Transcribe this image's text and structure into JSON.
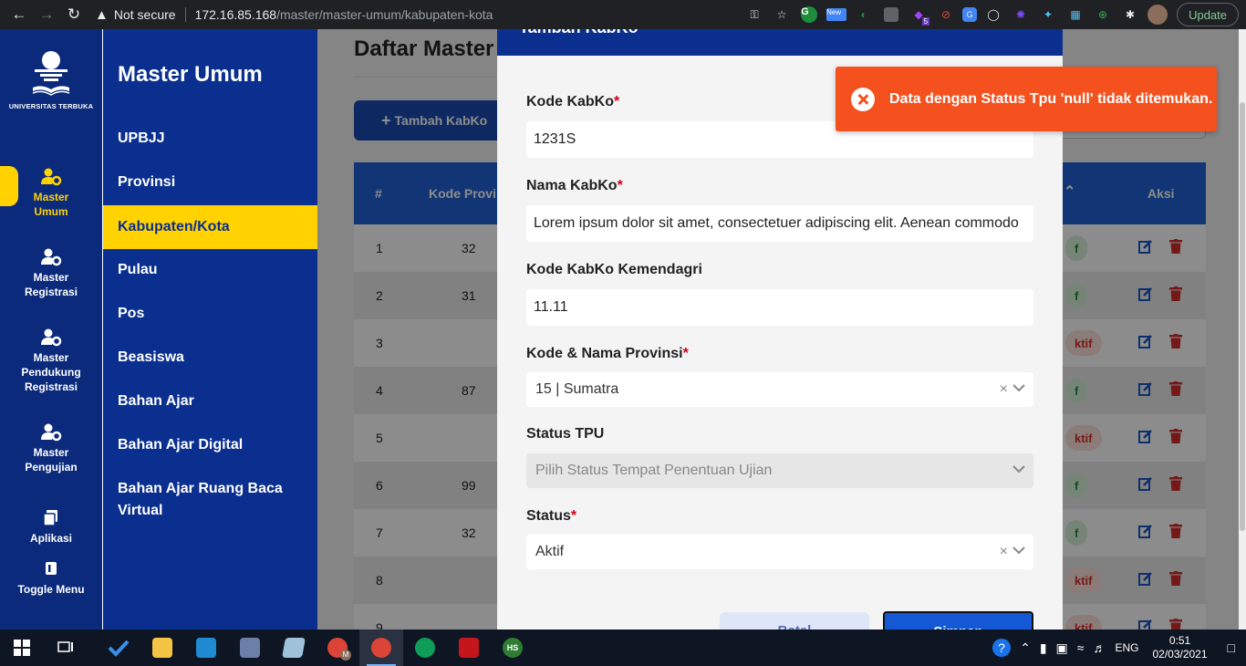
{
  "browser": {
    "security_label": "Not secure",
    "url_host": "172.16.85.168",
    "url_path": "/master/master-umum/kabupaten-kota",
    "ext_new_label": "New",
    "ext_badge_count": "5",
    "update_label": "Update"
  },
  "rail": {
    "logo_text": "UNIVERSITAS TERBUKA",
    "items": [
      {
        "label": "Master Umum"
      },
      {
        "label": "Master Registrasi"
      },
      {
        "label": "Master Pendukung Registrasi"
      },
      {
        "label": "Master Pengujian"
      },
      {
        "label": "Aplikasi"
      },
      {
        "label": "Toggle Menu"
      }
    ]
  },
  "submenu": {
    "title": "Master Umum",
    "items": [
      {
        "label": "UPBJJ"
      },
      {
        "label": "Provinsi"
      },
      {
        "label": "Kabupaten/Kota"
      },
      {
        "label": "Pulau"
      },
      {
        "label": "Pos"
      },
      {
        "label": "Beasiswa"
      },
      {
        "label": "Bahan Ajar"
      },
      {
        "label": "Bahan Ajar Digital"
      },
      {
        "label": "Bahan Ajar Ruang Baca Virtual"
      }
    ],
    "active_index": 2
  },
  "main": {
    "title": "Daftar Master",
    "add_button": "Tambah KabKo",
    "table": {
      "headers": {
        "no": "#",
        "kode_provinsi": "Kode Provi",
        "aksi": "Aksi"
      },
      "rows": [
        {
          "no": "1",
          "kode": "32",
          "status": "f",
          "status_type": "green"
        },
        {
          "no": "2",
          "kode": "31",
          "status": "f",
          "status_type": "green"
        },
        {
          "no": "3",
          "kode": "",
          "status": "ktif",
          "status_type": "red"
        },
        {
          "no": "4",
          "kode": "87",
          "status": "f",
          "status_type": "green"
        },
        {
          "no": "5",
          "kode": "",
          "status": "ktif",
          "status_type": "red"
        },
        {
          "no": "6",
          "kode": "99",
          "status": "f",
          "status_type": "green"
        },
        {
          "no": "7",
          "kode": "32",
          "status": "f",
          "status_type": "green"
        },
        {
          "no": "8",
          "kode": "",
          "status": "ktif",
          "status_type": "red"
        },
        {
          "no": "9",
          "kode": "",
          "status": "ktif",
          "status_type": "red"
        }
      ]
    }
  },
  "modal": {
    "title": "Tambah KabKo",
    "fields": {
      "kode_kabko": {
        "label": "Kode KabKo",
        "value": "1231S"
      },
      "nama_kabko": {
        "label": "Nama KabKo",
        "value": "Lorem ipsum dolor sit amet, consectetuer adipiscing elit. Aenean commodo"
      },
      "kode_kemendagri": {
        "label": "Kode KabKo Kemendagri",
        "value": "11.11"
      },
      "provinsi": {
        "label": "Kode & Nama Provinsi",
        "value": "15 | Sumatra"
      },
      "status_tpu": {
        "label": "Status TPU",
        "placeholder": "Pilih Status Tempat Penentuan Ujian"
      },
      "status": {
        "label": "Status",
        "value": "Aktif"
      }
    },
    "required_mark": "*",
    "clear_glyph": "×",
    "reset_label": "Batal",
    "save_label": "Simpan"
  },
  "toast": {
    "message": "Data dengan Status Tpu 'null' tidak ditemukan."
  },
  "taskbar": {
    "lang": "ENG",
    "time": "0:51",
    "date": "02/03/2021",
    "badge_m": "M",
    "badge_hs": "HS"
  },
  "colors": {
    "primary": "#0a2f8f",
    "accent": "#ffd200",
    "table_header": "#2161d6",
    "toast": "#f4511e",
    "required": "#d0021b"
  }
}
